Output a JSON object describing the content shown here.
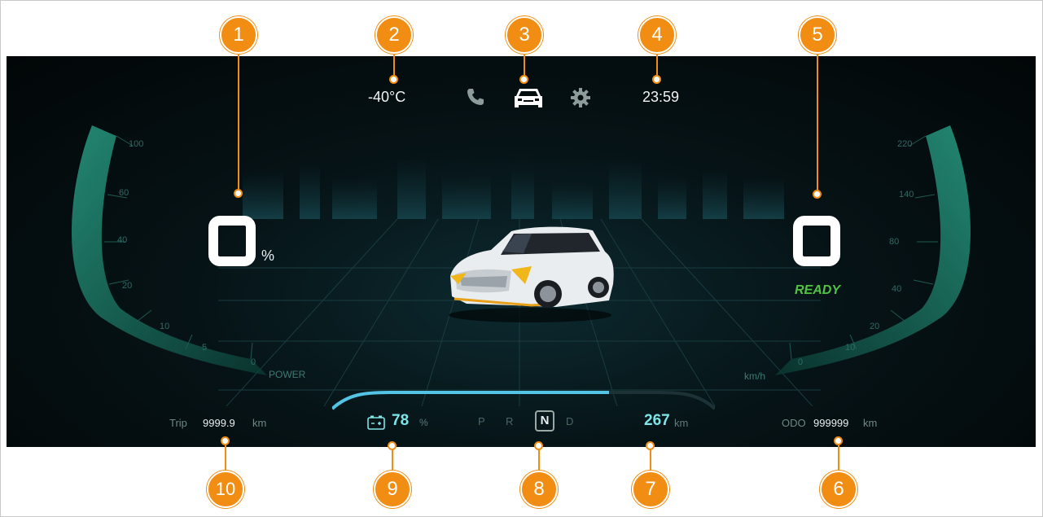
{
  "status_bar": {
    "temperature": "-40°C",
    "time": "23:59",
    "icons": [
      "phone-icon",
      "car-icon",
      "gear-icon"
    ]
  },
  "power_gauge": {
    "ticks": [
      "100",
      "60",
      "40",
      "20",
      "10",
      "5",
      "0"
    ],
    "label": "POWER",
    "value_unit": "%"
  },
  "speed_gauge": {
    "ticks": [
      "220",
      "140",
      "80",
      "40",
      "20",
      "10",
      "0"
    ],
    "unit": "km/h",
    "status": "READY"
  },
  "bottom_bar": {
    "trip_label": "Trip",
    "trip_value": "9999.9",
    "trip_unit": "km",
    "battery_icon": "battery-icon",
    "soc_value": "78",
    "soc_unit": "%",
    "gears": [
      "P",
      "R",
      "N",
      "D"
    ],
    "selected_gear": "N",
    "range_value": "267",
    "range_unit": "km",
    "odo_label": "ODO",
    "odo_value": "999999",
    "odo_unit": "km"
  },
  "callouts": [
    "1",
    "2",
    "3",
    "4",
    "5",
    "6",
    "7",
    "8",
    "9",
    "10"
  ],
  "colors": {
    "callout": "#f18d12",
    "gauge": "#1e6e60",
    "ready": "#52c243",
    "accent": "#7fe4e8",
    "background": "#050d0f"
  }
}
